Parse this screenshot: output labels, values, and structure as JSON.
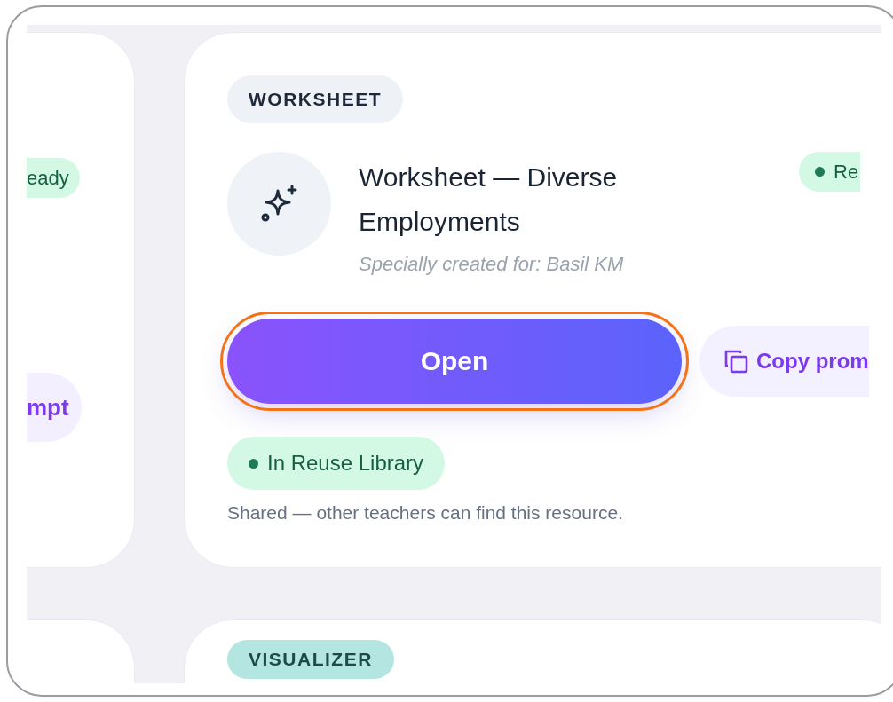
{
  "left_card": {
    "status_badge": {
      "label": "eady"
    },
    "button": {
      "label": "mpt"
    }
  },
  "main_card": {
    "type_badge": "WORKSHEET",
    "title": "Worksheet — Diverse Employments",
    "subtitle": "Specially created for: Basil KM",
    "status_badge": {
      "label": "Re"
    },
    "open_button": {
      "label": "Open",
      "highlighted": true
    },
    "copy_button": {
      "label": "Copy prom"
    },
    "library_badge": {
      "label": "In Reuse Library"
    },
    "caption": "Shared — other teachers can find this resource."
  },
  "next_card": {
    "type_badge": "VISUALIZER"
  }
}
